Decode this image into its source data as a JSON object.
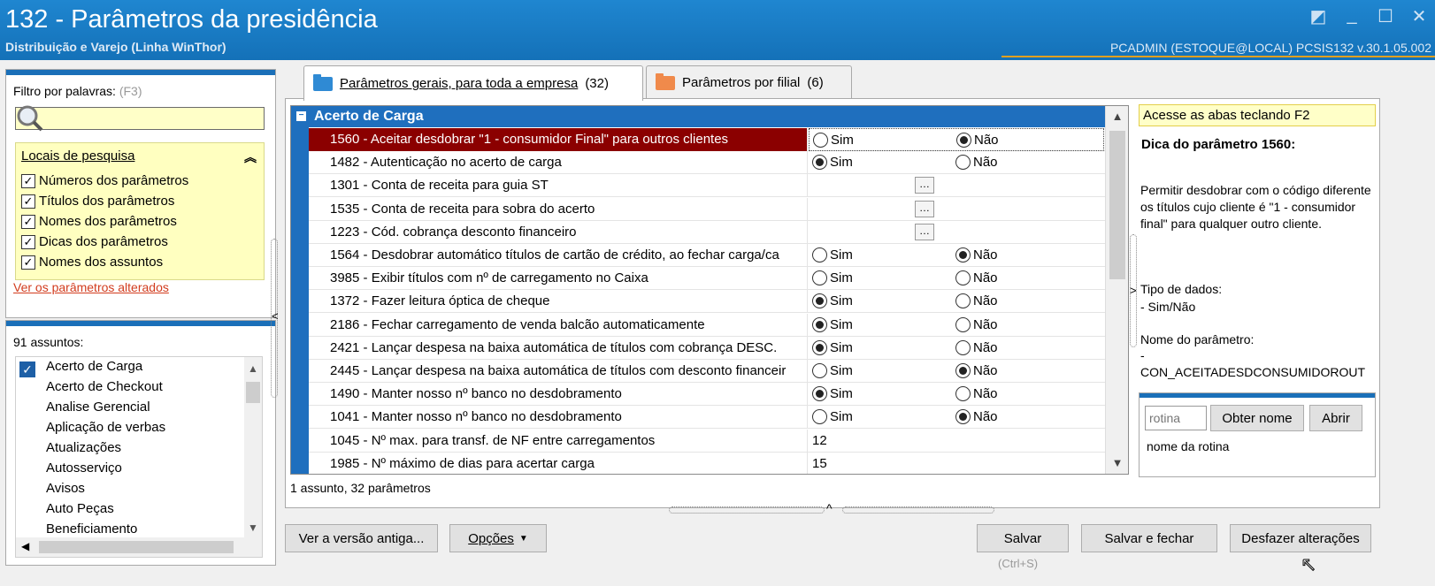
{
  "titlebar": {
    "title": "132 - Parâmetros da presidência",
    "subtitle": "Distribuição e Varejo (Linha WinThor)",
    "user_info": "PCADMIN (ESTOQUE@LOCAL)   PCSIS132  v.30.1.05.002"
  },
  "filter": {
    "label": "Filtro por palavras:",
    "hotkey": "(F3)",
    "search_value": "",
    "locais_title": "Locais de pesquisa",
    "options": [
      {
        "label": "Números dos parâmetros",
        "checked": true
      },
      {
        "label": "Títulos dos parâmetros",
        "checked": true
      },
      {
        "label": "Nomes dos parâmetros",
        "checked": true
      },
      {
        "label": "Dicas dos parâmetros",
        "checked": true
      },
      {
        "label": "Nomes dos assuntos",
        "checked": true
      }
    ],
    "changed_link": "Ver os parâmetros alterados"
  },
  "assuntos": {
    "count_label": "91 assuntos:",
    "items": [
      "Acerto de Carga",
      "Acerto de Checkout",
      "Analise Gerencial",
      "Aplicação de verbas",
      "Atualizações",
      "Autosserviço",
      "Avisos",
      "Auto Peças",
      "Beneficiamento"
    ],
    "selected": "Acerto de Carga"
  },
  "tabs": [
    {
      "label": "Parâmetros gerais, para toda a empresa",
      "count": "(32)",
      "active": true
    },
    {
      "label": "Parâmetros por filial",
      "count": "(6)",
      "active": false
    }
  ],
  "grid": {
    "group": "Acerto de Carga",
    "yes_label": "Sim",
    "no_label": "Não",
    "rows": [
      {
        "name": "1560 - Aceitar desdobrar \"1 - consumidor Final\" para outros clientes",
        "type": "bool",
        "value": "Não",
        "selected": true
      },
      {
        "name": "1482 - Autenticação no acerto de carga",
        "type": "bool",
        "value": "Sim"
      },
      {
        "name": "1301 - Conta de receita para guia ST",
        "type": "lookup",
        "value": ""
      },
      {
        "name": "1535 - Conta de receita para sobra do acerto",
        "type": "lookup",
        "value": ""
      },
      {
        "name": "1223 - Cód. cobrança desconto financeiro",
        "type": "lookup",
        "value": ""
      },
      {
        "name": "1564 - Desdobrar automático títulos de cartão de crédito, ao fechar carga/ca",
        "type": "bool",
        "value": "Não"
      },
      {
        "name": "3985 - Exibir títulos com nº de carregamento no Caixa",
        "type": "bool",
        "value": "none"
      },
      {
        "name": "1372 - Fazer leitura óptica de cheque",
        "type": "bool",
        "value": "Sim"
      },
      {
        "name": "2186 - Fechar carregamento de venda balcão automaticamente",
        "type": "bool",
        "value": "Sim"
      },
      {
        "name": "2421 - Lançar despesa na baixa automática de títulos com cobrança DESC.",
        "type": "bool",
        "value": "Sim"
      },
      {
        "name": "2445 - Lançar despesa na baixa automática de títulos com desconto financeir",
        "type": "bool",
        "value": "Não"
      },
      {
        "name": "1490 - Manter nosso nº banco no desdobramento",
        "type": "bool",
        "value": "Sim"
      },
      {
        "name": "1041 - Manter nosso nº banco no desdobramento",
        "type": "bool",
        "value": "Não"
      },
      {
        "name": "1045 - Nº max. para transf. de NF entre carregamentos",
        "type": "number",
        "value": "12"
      },
      {
        "name": "1985 - Nº máximo de dias para acertar carga",
        "type": "number",
        "value": "15"
      }
    ],
    "summary": "1 assunto, 32 parâmetros"
  },
  "hint": {
    "bar": "Acesse as abas teclando F2",
    "title": "Dica do parâmetro 1560:",
    "body": "Permitir desdobrar com o código diferente os títulos cujo cliente é \"1 - consumidor final\" para qualquer outro cliente.",
    "tipo_label": "Tipo de dados:",
    "tipo_value": " - Sim/Não",
    "nome_label": "Nome do parâmetro:",
    "nome_dash": " -",
    "nome_value": "CON_ACEITADESDCONSUMIDOROUT"
  },
  "rotina": {
    "placeholder": "rotina",
    "obter_label": "Obter nome",
    "abrir_label": "Abrir",
    "nome_label": "nome da rotina"
  },
  "bottom": {
    "versao_antiga": "Ver a versão antiga...",
    "opcoes": "Opções",
    "salvar": "Salvar",
    "salvar_shortcut": "(Ctrl+S)",
    "salvar_fechar": "Salvar e fechar",
    "desfazer": "Desfazer alterações"
  }
}
